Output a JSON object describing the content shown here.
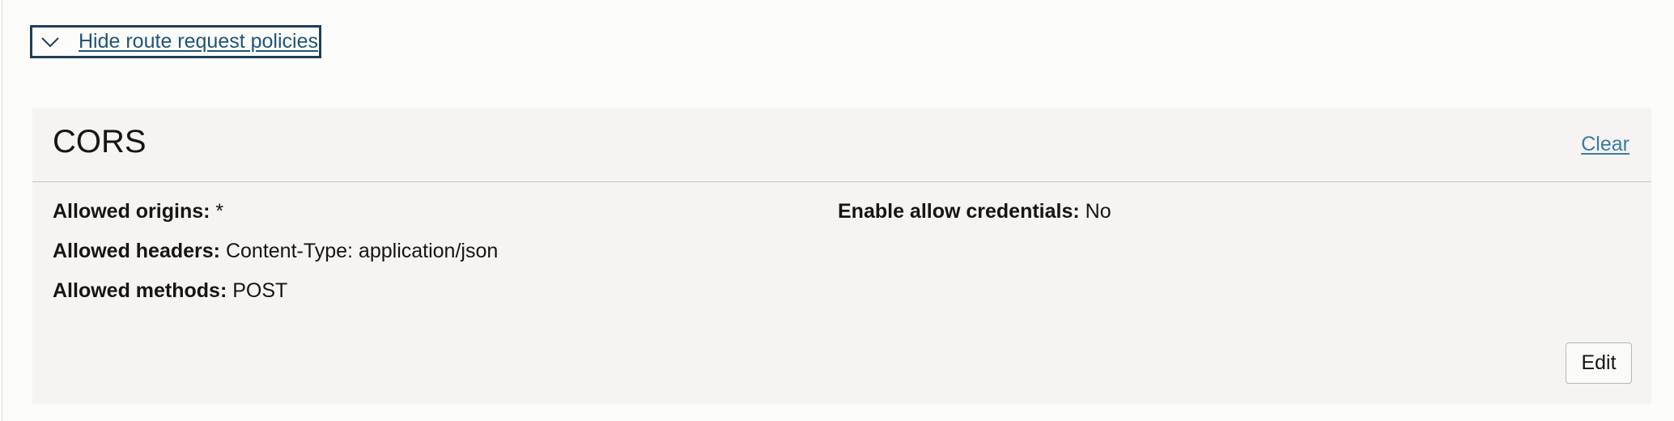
{
  "toggle": {
    "label": "Hide route request policies",
    "icon": "chevron-down-icon"
  },
  "cors": {
    "title": "CORS",
    "clear_label": "Clear",
    "fields": {
      "allowed_origins": {
        "key": "Allowed origins:",
        "value": "*"
      },
      "allowed_headers": {
        "key": "Allowed headers:",
        "value": "Content-Type: application/json"
      },
      "allowed_methods": {
        "key": "Allowed methods:",
        "value": "POST"
      },
      "allow_credentials": {
        "key": "Enable allow credentials:",
        "value": "No"
      }
    },
    "edit_label": "Edit"
  },
  "colors": {
    "link": "#1f5577",
    "focus_border": "#1f3f55",
    "clear_link": "#3a7ba6",
    "panel_bg": "#f5f4f2",
    "page_bg": "#fcfcfb"
  }
}
